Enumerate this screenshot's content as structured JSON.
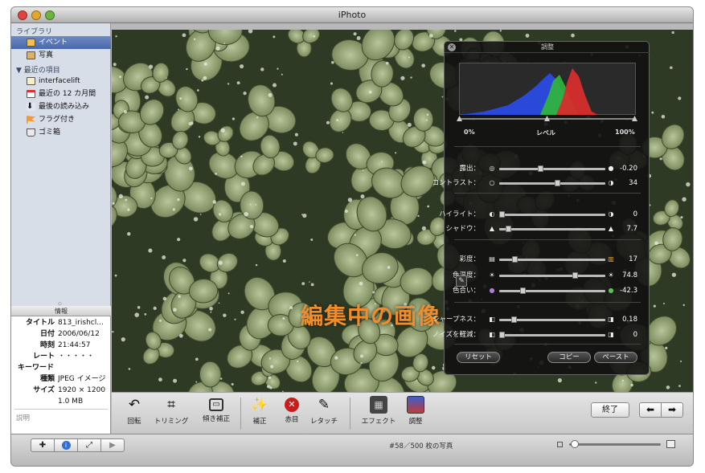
{
  "window": {
    "title": "iPhoto"
  },
  "sidebar": {
    "library_header": "ライブラリ",
    "recent_header": "最近の項目",
    "library_items": [
      {
        "label": "イベント",
        "icon": "events-icon",
        "selected": true
      },
      {
        "label": "写真",
        "icon": "photos-icon",
        "selected": false
      }
    ],
    "recent_items": [
      {
        "label": "interfacelift",
        "icon": "album-icon"
      },
      {
        "label": "最近の 12 カ月間",
        "icon": "calendar-icon"
      },
      {
        "label": "最後の読み込み",
        "icon": "import-icon"
      },
      {
        "label": "フラグ付き",
        "icon": "flag-icon"
      },
      {
        "label": "ゴミ箱",
        "icon": "trash-icon"
      }
    ]
  },
  "info": {
    "header": "情報",
    "rows": [
      {
        "key": "タイトル",
        "value": "813_irishcl..."
      },
      {
        "key": "日付",
        "value": "2006/06/12"
      },
      {
        "key": "時刻",
        "value": "21:44:57"
      },
      {
        "key": "レート",
        "value": "・・・・・"
      },
      {
        "key": "キーワード",
        "value": ""
      },
      {
        "key": "種類",
        "value": "JPEG イメージ"
      },
      {
        "key": "サイズ",
        "value": "1920 × 1200"
      },
      {
        "key": "",
        "value": "1.0 MB"
      }
    ],
    "description_label": "説明"
  },
  "photo": {
    "overlay_text": "編集中の画像"
  },
  "adjust_panel": {
    "title": "調整",
    "levels": {
      "min_label": "0%",
      "center_label": "レベル",
      "max_label": "100%"
    },
    "sliders": [
      {
        "label": "露出：",
        "value": "-0.20",
        "position": 0.38,
        "left_icon": "aperture-icon",
        "right_icon": "aperture-open-icon",
        "group": 1
      },
      {
        "label": "コントラスト：",
        "value": "34",
        "position": 0.55,
        "left_icon": "circle-icon",
        "right_icon": "half-circle-icon",
        "group": 1
      },
      {
        "label": "ハイライト：",
        "value": "0",
        "position": 0.0,
        "left_icon": "highlight-icon",
        "right_icon": "highlight-max-icon",
        "group": 2
      },
      {
        "label": "シャドウ：",
        "value": "7.7",
        "position": 0.06,
        "left_icon": "shadow-icon",
        "right_icon": "shadow-max-icon",
        "group": 2
      },
      {
        "label": "彩度：",
        "value": "17",
        "position": 0.13,
        "left_icon": "grayscale-icon",
        "right_icon": "rainbow-icon",
        "group": 3
      },
      {
        "label": "色温度：",
        "value": "74.8",
        "position": 0.72,
        "left_icon": "sun-icon",
        "right_icon": "sun-warm-icon",
        "group": 3
      },
      {
        "label": "色合い：",
        "value": "-42.3",
        "position": 0.21,
        "left_icon": "purple-dot-icon",
        "right_icon": "green-dot-icon",
        "group": 3
      },
      {
        "label": "シャープネス：",
        "value": "0.18",
        "position": 0.12,
        "left_icon": "soft-icon",
        "right_icon": "sharp-icon",
        "group": 4
      },
      {
        "label": "ノイズを軽減：",
        "value": "0",
        "position": 0.0,
        "left_icon": "noise-icon",
        "right_icon": "noise-max-icon",
        "group": 4
      }
    ],
    "buttons": {
      "reset": "リセット",
      "copy": "コピー",
      "paste": "ペースト"
    }
  },
  "toolbar": {
    "tools": [
      {
        "label": "回転",
        "icon": "rotate-icon"
      },
      {
        "label": "トリミング",
        "icon": "crop-icon"
      },
      {
        "label": "傾き補正",
        "icon": "straighten-icon"
      },
      {
        "label": "補正",
        "icon": "enhance-wand-icon"
      },
      {
        "label": "赤目",
        "icon": "red-eye-icon"
      },
      {
        "label": "レタッチ",
        "icon": "retouch-brush-icon"
      },
      {
        "label": "エフェクト",
        "icon": "effects-grid-icon"
      },
      {
        "label": "調整",
        "icon": "adjust-icon"
      }
    ],
    "done_label": "終了"
  },
  "bottombar": {
    "count_text": "#58／500 枚の写真",
    "zoom_level": 0.02
  },
  "colors": {
    "overlay_text": "#f08d2a",
    "selection": "#4a68a8"
  }
}
